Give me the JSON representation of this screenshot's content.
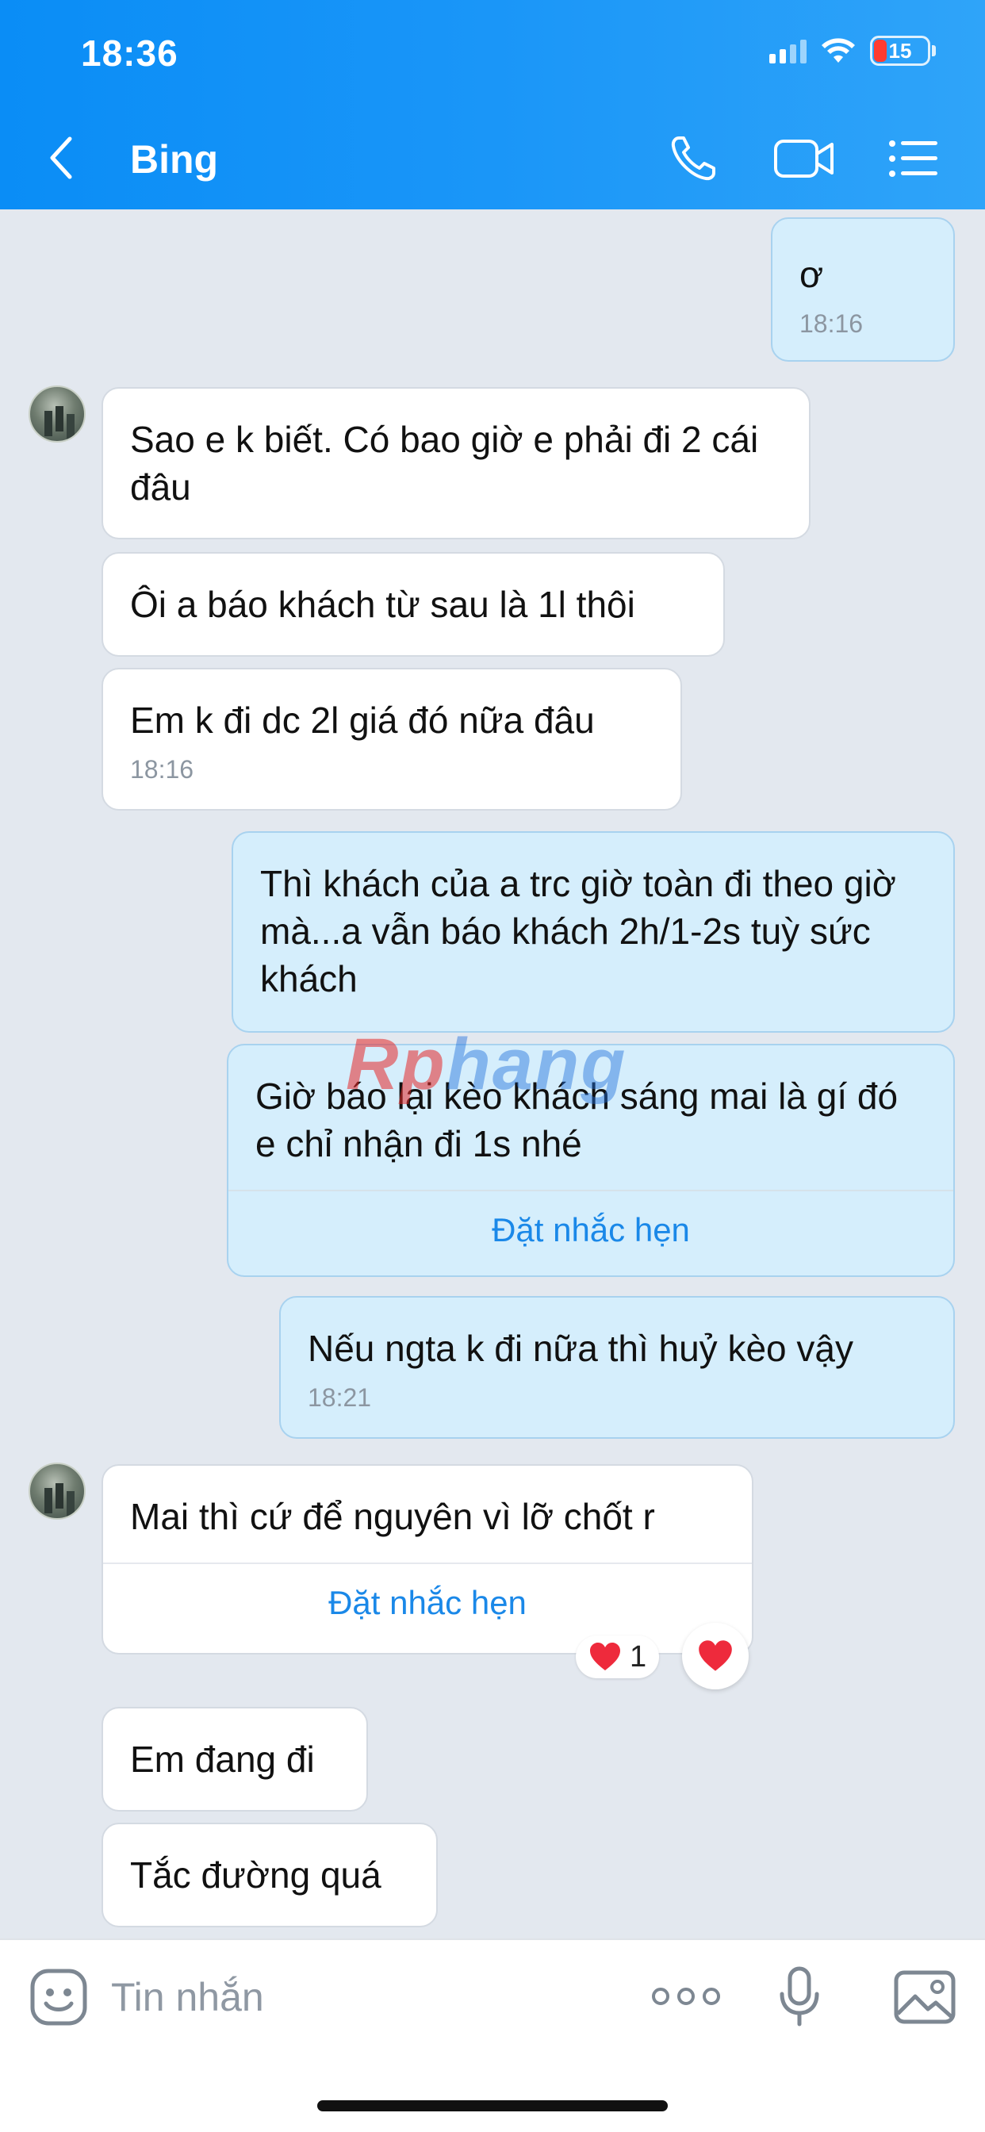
{
  "status_bar": {
    "time": "18:36",
    "battery_level": "15"
  },
  "header": {
    "back_label": "",
    "title": "Bing"
  },
  "messages": [
    {
      "dir": "out",
      "text": "ơ",
      "time": "18:16"
    },
    {
      "dir": "in",
      "text": "Sao e k biết. Có bao giờ e phải đi 2 cái đâu"
    },
    {
      "dir": "in",
      "text": "Ôi a báo khách từ sau là 1l thôi"
    },
    {
      "dir": "in",
      "text": "Em k đi dc 2l giá đó nữa đâu",
      "time": "18:16"
    },
    {
      "dir": "out",
      "text": "Thì khách của a trc giờ toàn đi theo giờ mà...a vẫn báo khách 2h/1-2s tuỳ sức khách"
    },
    {
      "dir": "out",
      "text": "Giờ báo lại kèo khách sáng mai là gí đó e chỉ nhận đi 1s nhé",
      "action": "Đặt nhắc hẹn"
    },
    {
      "dir": "out",
      "text": "Nếu ngta k đi nữa thì huỷ kèo vậy",
      "time": "18:21"
    },
    {
      "dir": "in",
      "text": "Mai thì cứ để nguyên vì lỡ chốt r",
      "action": "Đặt nhắc hẹn",
      "reaction_count": "1"
    },
    {
      "dir": "in",
      "text": "Em đang đi"
    },
    {
      "dir": "in",
      "text": "Tắc đường quá"
    }
  ],
  "watermark": {
    "part1": "Rp",
    "part2": "hang"
  },
  "input": {
    "placeholder": "Tin nhắn"
  },
  "colors": {
    "header_blue": "#0a8df6",
    "out_bubble": "#d5eefc",
    "link": "#1a88e8"
  }
}
